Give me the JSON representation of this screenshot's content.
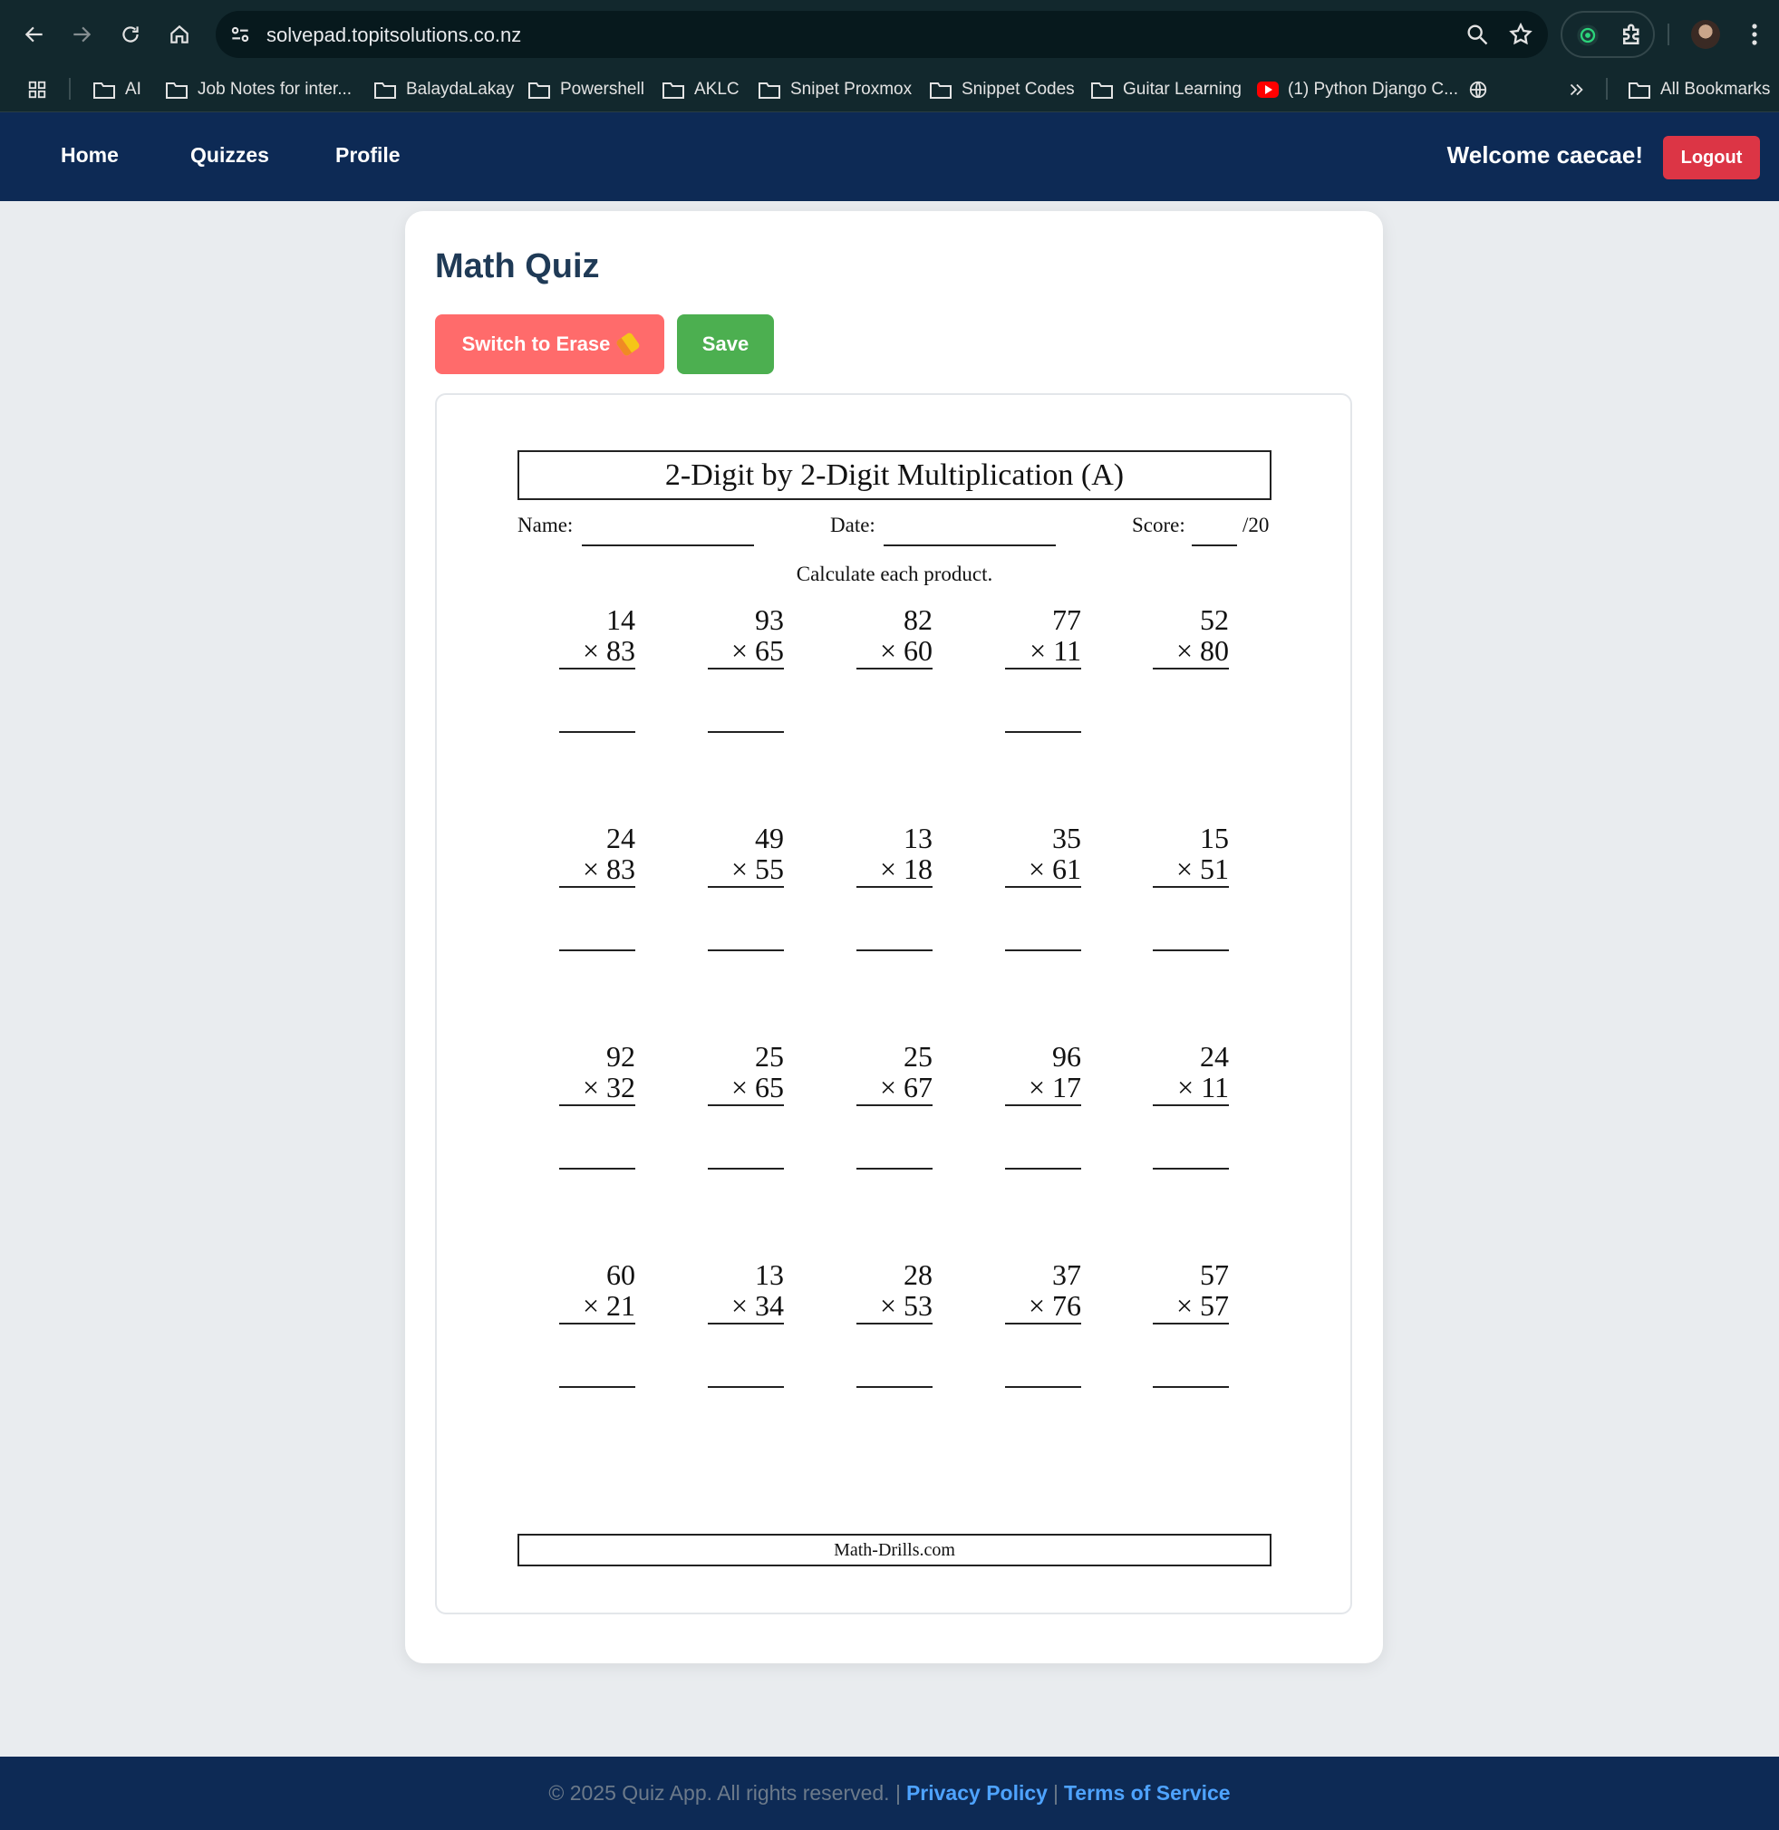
{
  "browser": {
    "url": "solvepad.topitsolutions.co.nz",
    "bookmarks": [
      "AI",
      "Job Notes for inter...",
      "BalaydaLakay",
      "Powershell",
      "AKLC",
      "Snipet Proxmox",
      "Snippet Codes",
      "Guitar Learning",
      "(1) Python Django C...",
      "All Bookmarks"
    ]
  },
  "nav": {
    "links": [
      "Home",
      "Quizzes",
      "Profile"
    ],
    "welcome": "Welcome caecae!",
    "logout": "Logout"
  },
  "quiz": {
    "title": "Math Quiz",
    "erase_button": "Switch to Erase",
    "save_button": "Save"
  },
  "worksheet": {
    "title": "2-Digit by 2-Digit Multiplication (A)",
    "name_label": "Name:",
    "date_label": "Date:",
    "score_label": "Score:",
    "score_total": "/20",
    "instruction": "Calculate each product.",
    "rows": [
      [
        {
          "top": "14",
          "bottom": "× 83"
        },
        {
          "top": "93",
          "bottom": "× 65"
        },
        {
          "top": "82",
          "bottom": "× 60"
        },
        {
          "top": "77",
          "bottom": "× 11"
        },
        {
          "top": "52",
          "bottom": "× 80"
        }
      ],
      [
        {
          "top": "24",
          "bottom": "× 83"
        },
        {
          "top": "49",
          "bottom": "× 55"
        },
        {
          "top": "13",
          "bottom": "× 18"
        },
        {
          "top": "35",
          "bottom": "× 61"
        },
        {
          "top": "15",
          "bottom": "× 51"
        }
      ],
      [
        {
          "top": "92",
          "bottom": "× 32"
        },
        {
          "top": "25",
          "bottom": "× 65"
        },
        {
          "top": "25",
          "bottom": "× 67"
        },
        {
          "top": "96",
          "bottom": "× 17"
        },
        {
          "top": "24",
          "bottom": "× 11"
        }
      ],
      [
        {
          "top": "60",
          "bottom": "× 21"
        },
        {
          "top": "13",
          "bottom": "× 34"
        },
        {
          "top": "28",
          "bottom": "× 53"
        },
        {
          "top": "37",
          "bottom": "× 76"
        },
        {
          "top": "57",
          "bottom": "× 57"
        }
      ]
    ],
    "footer": "Math-Drills.com"
  },
  "footer": {
    "copyright": "© 2025 Quiz App. All rights reserved. |",
    "privacy": "Privacy Policy",
    "divider": "|",
    "terms": "Terms of Service"
  },
  "colors": {
    "nav_bg": "#0d2a55",
    "erase_button": "#ff6b6b",
    "save_button": "#4caf50",
    "logout_button": "#dc3545",
    "footer_link": "#4ea3ff"
  }
}
